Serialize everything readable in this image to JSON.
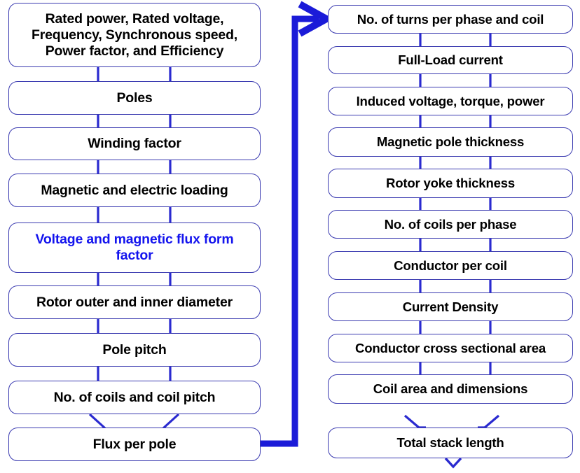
{
  "diagram": {
    "title": "Electrical machine design calculation sequence flowchart",
    "colors": {
      "box_border": "#3a3ab0",
      "connector": "#2a2ad0",
      "accent_text": "#1414ee",
      "thick_arrow": "#1b1bd8",
      "text": "#000000",
      "background": "#ffffff"
    },
    "left_column": {
      "name": "input-and-geometry-column",
      "nodes": [
        {
          "id": "rated-parameters",
          "label": "Rated power, Rated voltage, Frequency, Synchronous speed, Power factor, and Efficiency",
          "lines": [
            "Rated power, Rated voltage,",
            "Frequency, Synchronous speed,",
            "Power factor, and Efficiency"
          ],
          "accent": false
        },
        {
          "id": "poles",
          "label": "Poles",
          "lines": [
            "Poles"
          ],
          "accent": false
        },
        {
          "id": "winding-factor",
          "label": "Winding factor",
          "lines": [
            "Winding factor"
          ],
          "accent": false
        },
        {
          "id": "magnetic-electric-loading",
          "label": "Magnetic and electric loading",
          "lines": [
            "Magnetic and electric loading"
          ],
          "accent": false
        },
        {
          "id": "voltage-flux-form-factor",
          "label": "Voltage and magnetic flux form factor",
          "lines": [
            "Voltage and magnetic flux form",
            "factor"
          ],
          "accent": true
        },
        {
          "id": "rotor-diameters",
          "label": "Rotor outer and inner diameter",
          "lines": [
            "Rotor outer and inner diameter"
          ],
          "accent": false
        },
        {
          "id": "pole-pitch",
          "label": "Pole pitch",
          "lines": [
            "Pole pitch"
          ],
          "accent": false
        },
        {
          "id": "coils-and-coil-pitch",
          "label": "No. of coils and coil pitch",
          "lines": [
            "No. of coils and coil pitch"
          ],
          "accent": false
        },
        {
          "id": "flux-per-pole",
          "label": "Flux per pole",
          "lines": [
            "Flux per pole"
          ],
          "accent": false
        }
      ]
    },
    "right_column": {
      "name": "winding-and-sizing-column",
      "nodes": [
        {
          "id": "turns-per-phase-and-coil",
          "label": "No. of turns per phase and coil",
          "lines": [
            "No. of turns per phase and coil"
          ],
          "accent": false
        },
        {
          "id": "full-load-current",
          "label": "Full-Load current",
          "lines": [
            "Full-Load current"
          ],
          "accent": false
        },
        {
          "id": "induced-voltage-torque-power",
          "label": "Induced voltage, torque, power",
          "lines": [
            "Induced voltage, torque, power"
          ],
          "accent": false
        },
        {
          "id": "magnetic-pole-thickness",
          "label": "Magnetic pole thickness",
          "lines": [
            "Magnetic pole thickness"
          ],
          "accent": false
        },
        {
          "id": "rotor-yoke-thickness",
          "label": "Rotor yoke thickness",
          "lines": [
            "Rotor yoke thickness"
          ],
          "accent": false
        },
        {
          "id": "coils-per-phase",
          "label": "No. of coils per phase",
          "lines": [
            "No. of coils per phase"
          ],
          "accent": false
        },
        {
          "id": "conductor-per-coil",
          "label": "Conductor per coil",
          "lines": [
            "Conductor per coil"
          ],
          "accent": false
        },
        {
          "id": "current-density",
          "label": "Current Density",
          "lines": [
            "Current Density"
          ],
          "accent": false
        },
        {
          "id": "conductor-cross-sectional-area",
          "label": "Conductor cross sectional area",
          "lines": [
            "Conductor cross sectional area"
          ],
          "accent": false
        },
        {
          "id": "coil-area-and-dimensions",
          "label": "Coil area and dimensions",
          "lines": [
            "Coil area and dimensions"
          ],
          "accent": false
        },
        {
          "id": "total-stack-length",
          "label": "Total stack length",
          "lines": [
            "Total stack length"
          ],
          "accent": false
        }
      ]
    },
    "connectors": {
      "feedback_arrow": {
        "name": "flux-to-turns-arrow",
        "from": "flux-per-pole",
        "to": "turns-per-phase-and-coil"
      },
      "exit_arrow": {
        "name": "total-stack-length-exit-arrow",
        "from": "total-stack-length",
        "to": ""
      }
    }
  }
}
